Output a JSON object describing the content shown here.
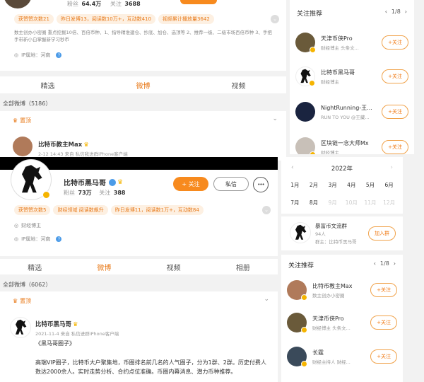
{
  "top": {
    "fans_label": "粉丝",
    "fans": "64.4万",
    "following_label": "关注",
    "following": "3688",
    "stat_badges": [
      "获赞赞次数21",
      "昨日发博13，阅读数10万+，互动数410",
      "视频累计播放量3642"
    ],
    "bio": "数主创办小密圈 重点挖掘10倍、百倍币种、1、指导精准建仓、抄底、加仓、选顶等 2、推荐一级、二级市场百倍币种 3、手把手带新小白掌握新学习秒币",
    "ip_label": "IP属地：河南",
    "tabs": [
      "精选",
      "微博",
      "视频"
    ]
  },
  "top_feed": {
    "all_label": "全部微博（5186）",
    "pinned_label": "置顶",
    "author": "比特币教主Max",
    "meta": "2-12 14:43 来自 私信我进群iPhone客户端"
  },
  "profile": {
    "name": "比特币黑马哥",
    "fans_label": "粉丝",
    "fans": "73万",
    "following_label": "关注",
    "following": "388",
    "follow_btn": "+ 关注",
    "message_btn": "私信",
    "more_btn": "•••",
    "stat_badges": [
      "获赞赞次数5",
      "财经领域 阅读数飙升",
      "昨日发博11，阅读数1万+，互动数84"
    ],
    "role": "财经博主",
    "ip_label": "IP属地：河南",
    "tabs": [
      "精选",
      "微博",
      "视频",
      "相册"
    ],
    "all_label": "全部微博（6062）",
    "pinned_label": "置顶",
    "post": {
      "author": "比特币黑马哥",
      "meta": "2021-11-4 来自 私信进群iPhone客户端",
      "title": "《黑马哥圈子》",
      "body": "高端VIP圈子，比特币大户聚集地，币圈排名前几名的人气圈子，分为1群、2群。历史付费人数达2000余人。实时走势分析、合约点位准确。币圈内幕消息、潜力币种推荐。"
    }
  },
  "rec_top": {
    "title": "关注推荐",
    "pager": "1/8",
    "follow_label": "+关注",
    "items": [
      {
        "name": "天津币侠Pro",
        "desc": "财经博主 头条文..."
      },
      {
        "name": "比特币黑马哥",
        "desc": "财经博主"
      },
      {
        "name": "NightRunning-王...",
        "desc": "RUN TO YOU @王藏..."
      },
      {
        "name": "区块链一念大师Mx",
        "desc": "财经博主"
      }
    ]
  },
  "calendar": {
    "year": "2022年",
    "months": [
      "1月",
      "2月",
      "3月",
      "4月",
      "5月",
      "6月",
      "7月",
      "8月",
      "9月",
      "10月",
      "11月",
      "12月"
    ]
  },
  "group": {
    "name": "暴富币文流群",
    "count": "94人",
    "owner": "群主：比特币黑马哥",
    "join": "加入群"
  },
  "rec_bottom": {
    "title": "关注推荐",
    "pager": "1/8",
    "follow_label": "+关注",
    "items": [
      {
        "name": "比特币教主Max",
        "desc": "数主创办小密圈"
      },
      {
        "name": "天津币侠Pro",
        "desc": "财经博主 头条文..."
      },
      {
        "name": "长霆",
        "desc": "财经主持人 财经..."
      }
    ]
  },
  "colors": {
    "accent": "#f07a14",
    "badge_bg": "#fdf0e2"
  }
}
